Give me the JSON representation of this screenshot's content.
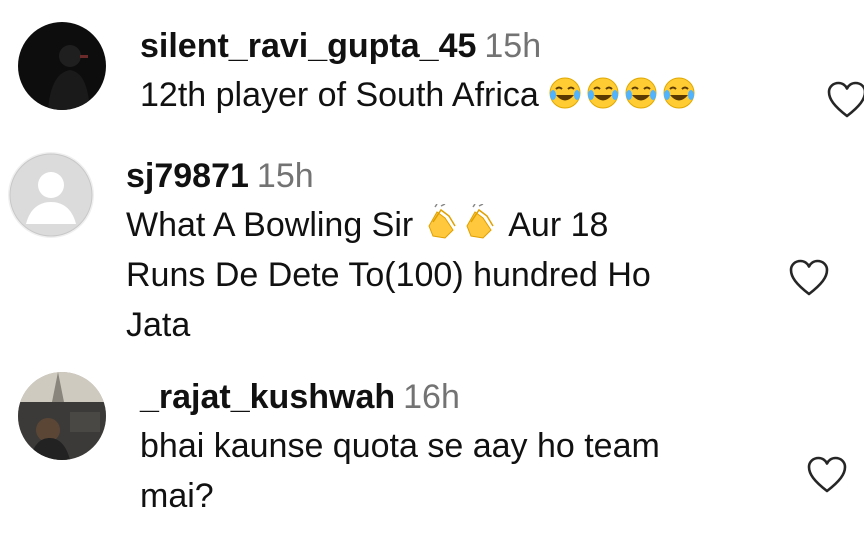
{
  "comments": [
    {
      "username": "silent_ravi_gupta_45",
      "time": "15h",
      "text_before_emoji": "12th player of South Africa ",
      "emoji": "face-with-tears-of-joy-emoji",
      "emoji_count": 4,
      "text_lines": [],
      "avatar": "dark-silhouette-avatar",
      "like_icon": "heart-outline-icon"
    },
    {
      "username": "sj79871",
      "time": "15h",
      "line1_before": "What A Bowling Sir ",
      "emoji": "clapping-hands-emoji",
      "emoji_count": 2,
      "line1_after": " Aur 18",
      "line2": "Runs De Dete To(100) hundred Ho",
      "line3": "Jata",
      "avatar": "default-profile-avatar",
      "like_icon": "heart-outline-icon"
    },
    {
      "username": "_rajat_kushwah",
      "time": "16h",
      "line1": "bhai kaunse quota se aay ho team",
      "line2": "mai?",
      "avatar": "photo-avatar",
      "like_icon": "heart-outline-icon"
    }
  ],
  "colors": {
    "text": "#111111",
    "timestamp": "#737373",
    "icon_stroke": "#262626",
    "default_avatar_bg": "#dbdbdb"
  }
}
